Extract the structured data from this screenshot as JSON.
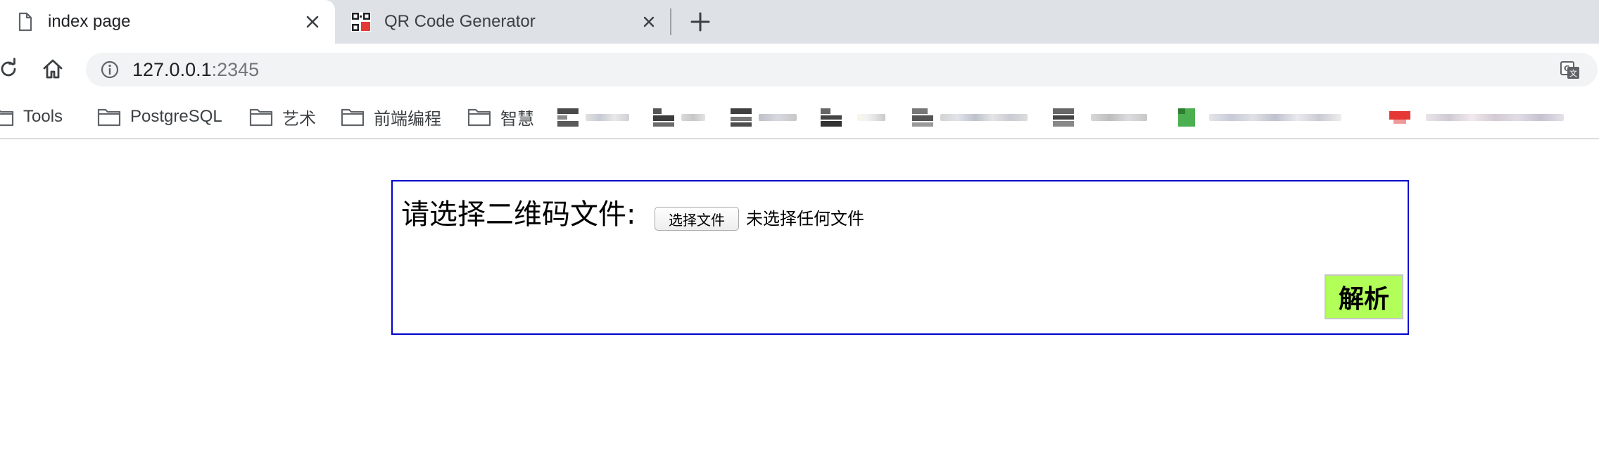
{
  "tabs": [
    {
      "title": "index page",
      "favicon": "document-icon",
      "active": true
    },
    {
      "title": "QR Code Generator",
      "favicon": "qr-code-icon",
      "active": false
    }
  ],
  "toolbar": {
    "url_host": "127.0.0.1",
    "url_port": ":2345"
  },
  "bookmarks": [
    {
      "label": "Tools",
      "icon": "folder-icon"
    },
    {
      "label": "PostgreSQL",
      "icon": "folder-icon"
    },
    {
      "label": "艺术",
      "icon": "folder-icon"
    },
    {
      "label": "前端编程",
      "icon": "folder-icon"
    },
    {
      "label": "智慧",
      "icon": "folder-icon"
    }
  ],
  "form": {
    "label": "请选择二维码文件:",
    "file_button": "选择文件",
    "file_status": "未选择任何文件",
    "submit_button": "解析"
  },
  "colors": {
    "form_border": "#0000cc",
    "submit_bg": "#b2ff59"
  }
}
